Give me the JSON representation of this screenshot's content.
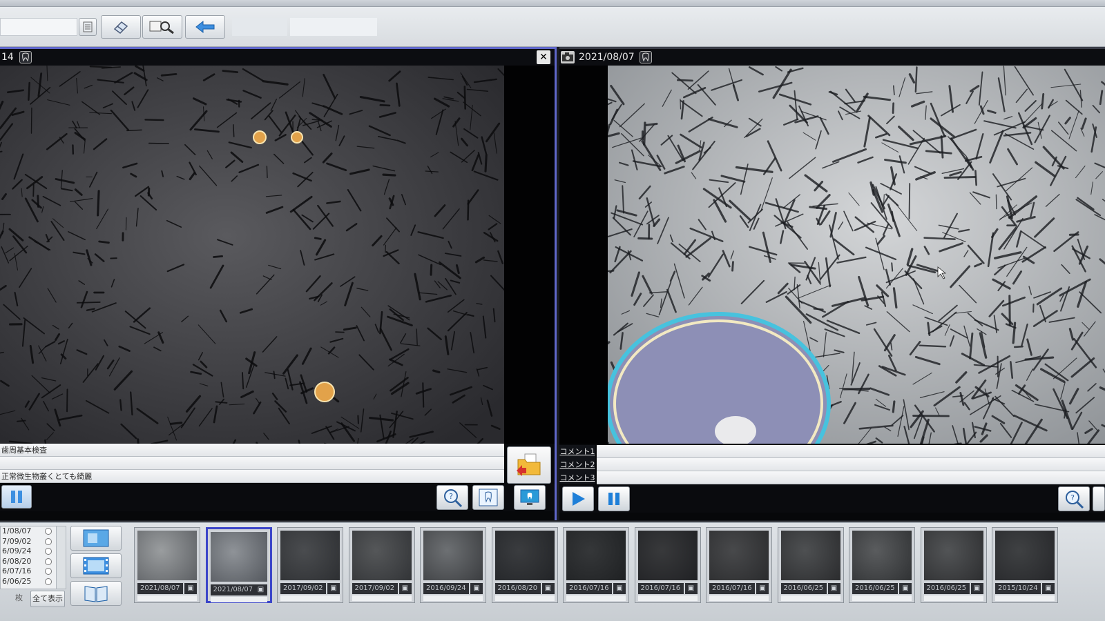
{
  "left_pane": {
    "header_label": "14",
    "close_label": "✕",
    "comments": [
      "歯周基本検査",
      "",
      "正常微生物叢くとても綺麗"
    ]
  },
  "right_pane": {
    "header_date": "2021/08/07",
    "comment_labels": [
      "コメント1",
      "コメント2",
      "コメント3"
    ]
  },
  "bottom": {
    "date_list": [
      "1/08/07",
      "7/09/02",
      "6/09/24",
      "6/08/20",
      "6/07/16",
      "6/06/25"
    ],
    "count_label": "枚",
    "show_all_label": "全て表示",
    "thumbnails": [
      {
        "date": "2021/08/07",
        "selected": false
      },
      {
        "date": "2021/08/07",
        "selected": true
      },
      {
        "date": "2017/09/02",
        "selected": false
      },
      {
        "date": "2017/09/02",
        "selected": false
      },
      {
        "date": "2016/09/24",
        "selected": false
      },
      {
        "date": "2016/08/20",
        "selected": false
      },
      {
        "date": "2016/07/16",
        "selected": false
      },
      {
        "date": "2016/07/16",
        "selected": false
      },
      {
        "date": "2016/07/16",
        "selected": false
      },
      {
        "date": "2016/06/25",
        "selected": false
      },
      {
        "date": "2016/06/25",
        "selected": false
      },
      {
        "date": "2016/06/25",
        "selected": false
      },
      {
        "date": "2015/10/24",
        "selected": false
      }
    ]
  },
  "icons": {
    "toolbar": [
      "list-icon",
      "eraser-icon",
      "search-zoom-icon",
      "back-arrow-icon"
    ],
    "left_controls": [
      "pause-icon",
      "zoom-icon",
      "fit-frame-icon",
      "monitor-icon",
      "folder-icon"
    ],
    "right_controls": [
      "play-icon",
      "pause-icon",
      "zoom-icon"
    ]
  },
  "colors": {
    "active_border": "#5f67c9",
    "selected_thumb": "#3c46c9",
    "play_blue": "#1e7fd8"
  }
}
